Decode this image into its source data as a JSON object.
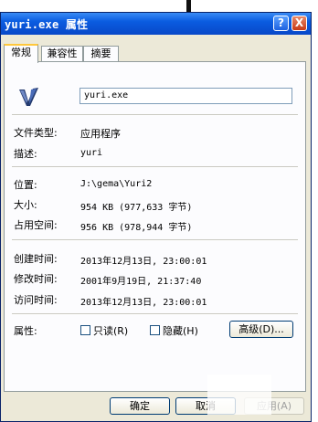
{
  "window": {
    "title": "yuri.exe 属性",
    "help_label": "?",
    "close_label": "X"
  },
  "tabs": [
    {
      "label": "常规",
      "active": true
    },
    {
      "label": "兼容性",
      "active": false
    },
    {
      "label": "摘要",
      "active": false
    }
  ],
  "general": {
    "file_name": "yuri.exe",
    "file_type_label": "文件类型:",
    "file_type_value": "应用程序",
    "description_label": "描述:",
    "description_value": "yuri",
    "location_label": "位置:",
    "location_value": "J:\\gema\\Yuri2",
    "size_label": "大小:",
    "size_value": "954 KB (977,633 字节)",
    "size_on_disk_label": "占用空间:",
    "size_on_disk_value": "956 KB (978,944 字节)",
    "created_label": "创建时间:",
    "created_value": "2013年12月13日, 23:00:01",
    "modified_label": "修改时间:",
    "modified_value": "2001年9月19日, 21:37:40",
    "accessed_label": "访问时间:",
    "accessed_value": "2013年12月13日, 23:00:01",
    "attributes_label": "属性:",
    "readonly_label": "只读(R)",
    "readonly_checked": false,
    "hidden_label": "隐藏(H)",
    "hidden_checked": false,
    "advanced_label": "高级(D)..."
  },
  "footer": {
    "ok_label": "确定",
    "cancel_label": "取消",
    "apply_label": "应用(A)"
  },
  "colors": {
    "titlebar": "#0a5ce0",
    "dialog_bg": "#ece9d8",
    "panel_bg": "#fcfcfe",
    "active_tab_accent": "#ffc83c"
  },
  "icons": {
    "app_icon": "yuri-app-icon"
  }
}
